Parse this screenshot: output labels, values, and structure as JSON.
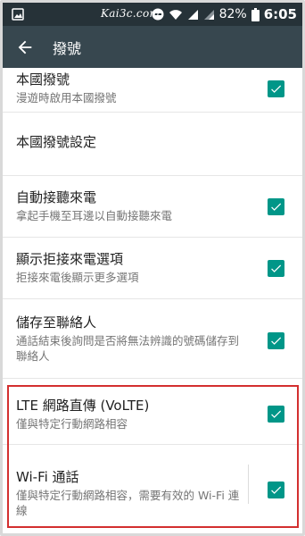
{
  "status": {
    "watermark": "Kai3c.com",
    "battery_percent": "82%",
    "time": "6:05"
  },
  "app_bar": {
    "title": "撥號"
  },
  "settings": [
    {
      "title": "本國撥號",
      "summary": "漫遊時啟用本國撥號",
      "checked": true
    },
    {
      "title": "本國撥號設定"
    },
    {
      "title": "自動接聽來電",
      "summary": "拿起手機至耳邊以自動接聽來電",
      "checked": true
    },
    {
      "title": "顯示拒接來電選項",
      "summary": "拒接來電後顯示更多選項",
      "checked": true
    },
    {
      "title": "儲存至聯絡人",
      "summary": "通話結束後詢問是否將無法辨識的號碼儲存到聯絡人",
      "checked": true
    },
    {
      "title": "LTE 網路直傳 (VoLTE)",
      "summary": "僅與特定行動網路相容",
      "checked": true
    },
    {
      "title": "Wi-Fi 通話",
      "summary": "僅與特定行動網路相容，需要有效的 Wi-Fi 連線",
      "checked": true
    }
  ],
  "colors": {
    "status_bar": "#263238",
    "app_bar": "#37474f",
    "checkbox": "#009688",
    "highlight": "#d32f2f"
  }
}
